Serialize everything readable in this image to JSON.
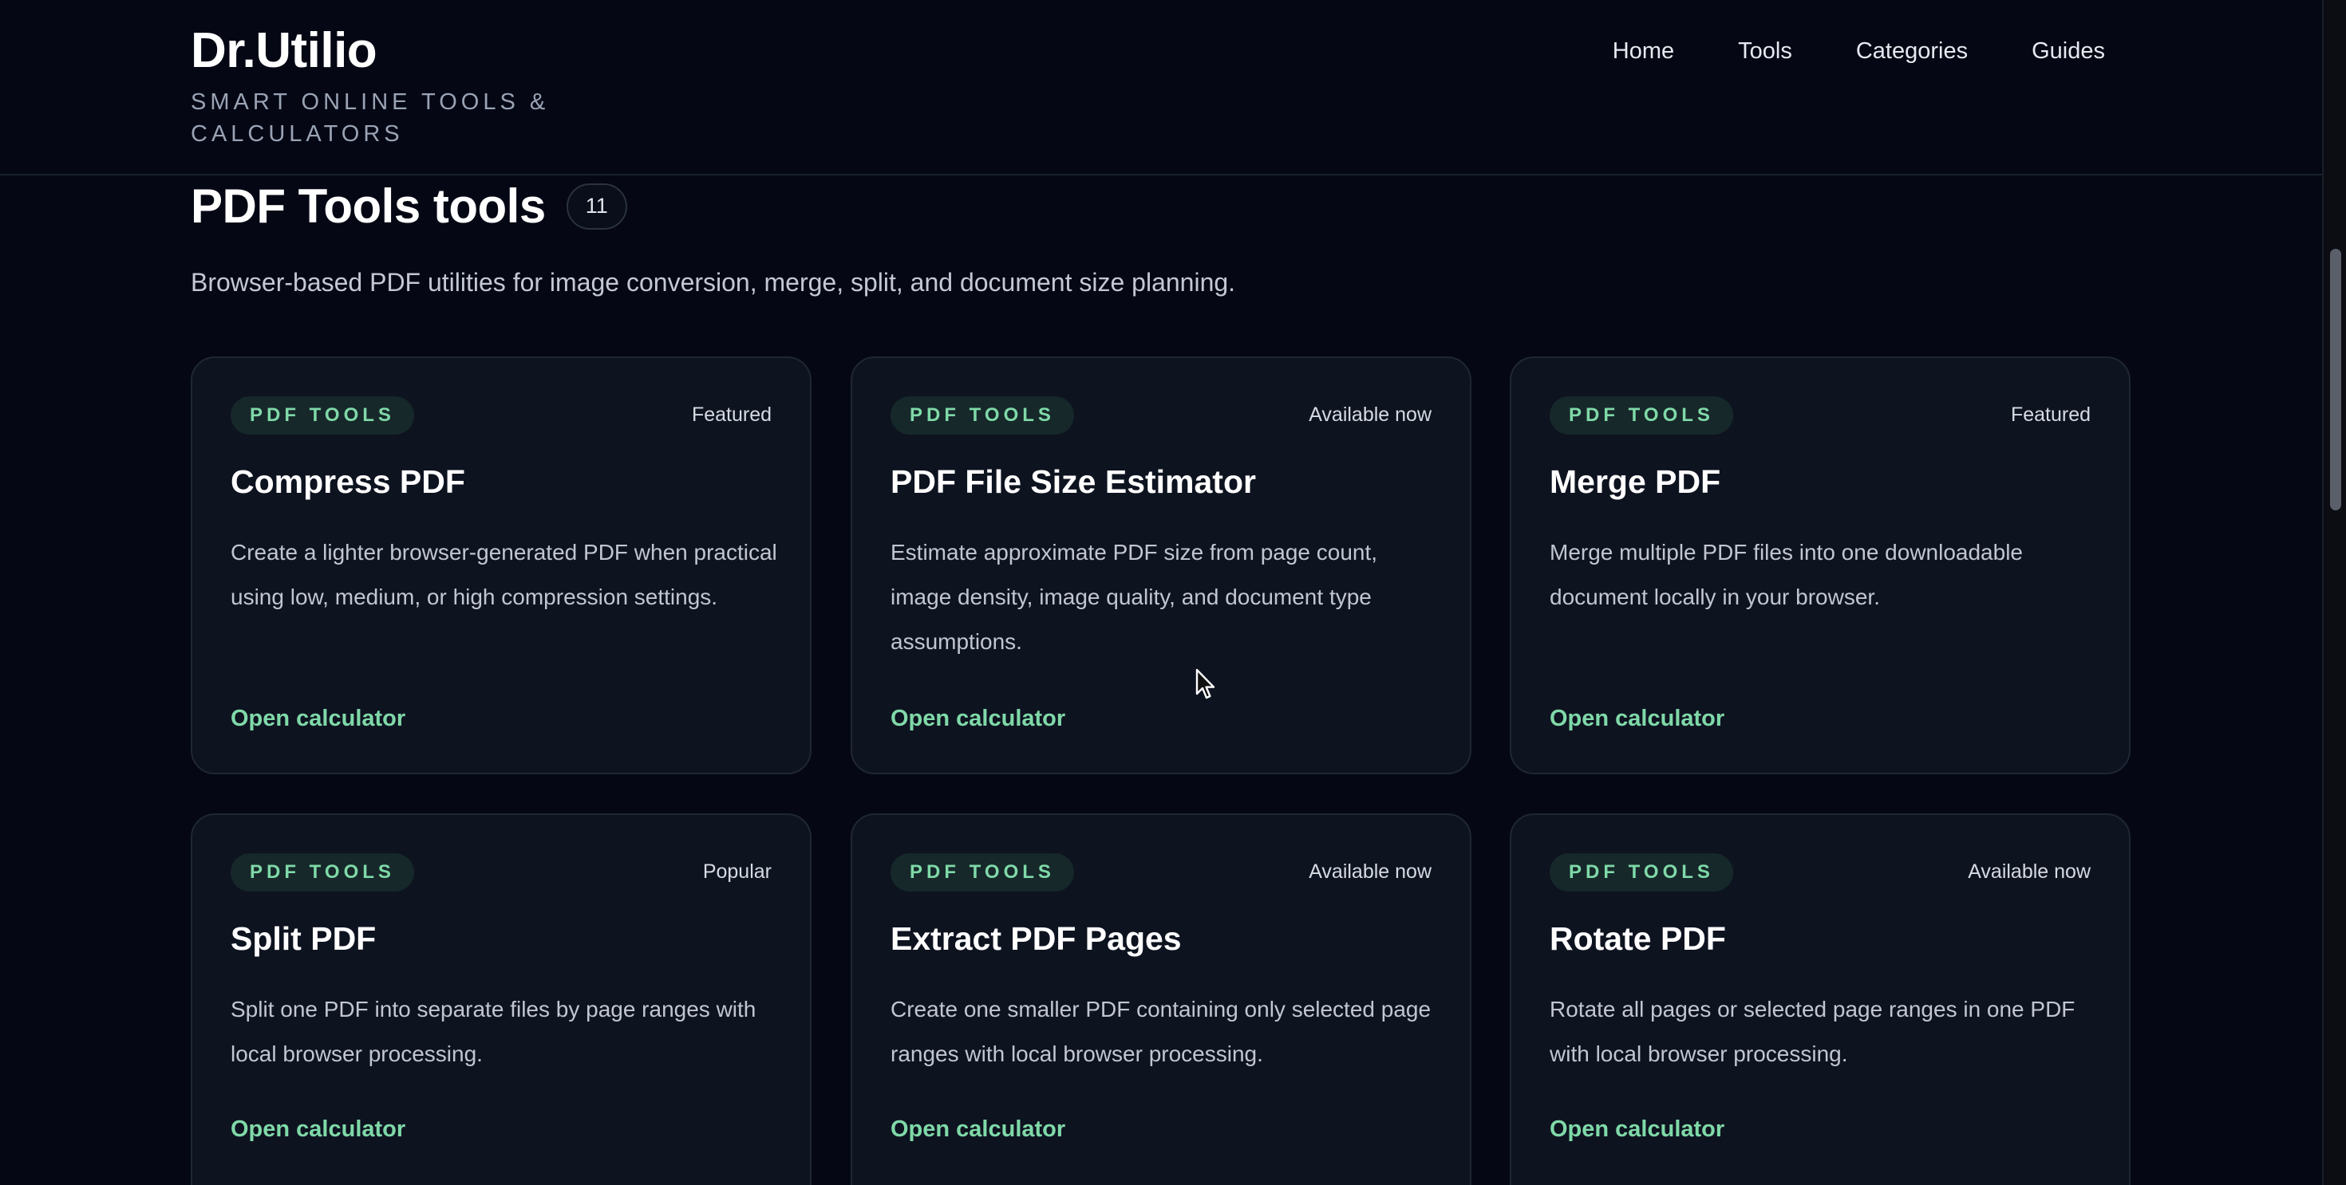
{
  "header": {
    "brand": "Dr.Utilio",
    "tagline": "SMART ONLINE TOOLS & CALCULATORS",
    "nav": [
      {
        "label": "Home"
      },
      {
        "label": "Tools"
      },
      {
        "label": "Categories"
      },
      {
        "label": "Guides"
      }
    ]
  },
  "section": {
    "title": "PDF Tools tools",
    "count": "11",
    "description": "Browser-based PDF utilities for image conversion, merge, split, and document size planning."
  },
  "cards": [
    {
      "category": "PDF TOOLS",
      "status": "Featured",
      "title": "Compress PDF",
      "description": "Create a lighter browser-generated PDF when practical using low, medium, or high compression settings.",
      "link": "Open calculator"
    },
    {
      "category": "PDF TOOLS",
      "status": "Available now",
      "title": "PDF File Size Estimator",
      "description": "Estimate approximate PDF size from page count, image density, image quality, and document type assumptions.",
      "link": "Open calculator"
    },
    {
      "category": "PDF TOOLS",
      "status": "Featured",
      "title": "Merge PDF",
      "description": "Merge multiple PDF files into one downloadable document locally in your browser.",
      "link": "Open calculator"
    },
    {
      "category": "PDF TOOLS",
      "status": "Popular",
      "title": "Split PDF",
      "description": "Split one PDF into separate files by page ranges with local browser processing.",
      "link": "Open calculator"
    },
    {
      "category": "PDF TOOLS",
      "status": "Available now",
      "title": "Extract PDF Pages",
      "description": "Create one smaller PDF containing only selected page ranges with local browser processing.",
      "link": "Open calculator"
    },
    {
      "category": "PDF TOOLS",
      "status": "Available now",
      "title": "Rotate PDF",
      "description": "Rotate all pages or selected page ranges in one PDF with local browser processing.",
      "link": "Open calculator"
    }
  ],
  "colors": {
    "background": "#050814",
    "card": "#0e1320",
    "accent": "#7fd9a8",
    "chip_bg": "#16282a"
  }
}
